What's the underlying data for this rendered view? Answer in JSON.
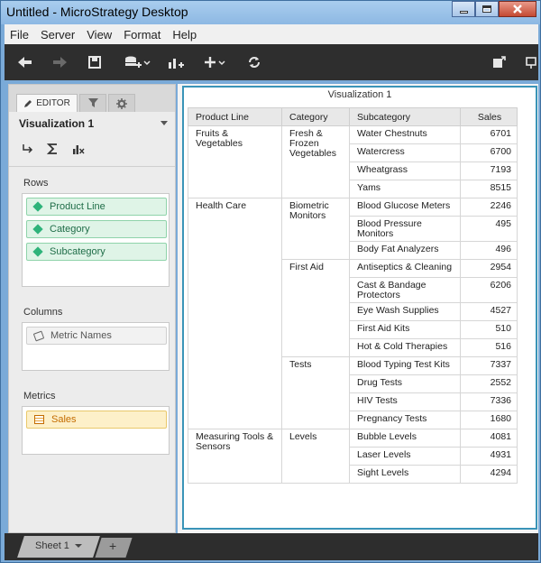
{
  "window": {
    "title": "Untitled - MicroStrategy Desktop"
  },
  "menu": [
    "File",
    "Server",
    "View",
    "Format",
    "Help"
  ],
  "toolbar": {
    "icons": [
      "undo-icon",
      "redo-icon",
      "save-icon",
      "add-data-icon",
      "insert-visualization-icon",
      "add-icon",
      "refresh-icon",
      "export-icon",
      "present-icon"
    ]
  },
  "editor": {
    "tabs": {
      "editor": "EDITOR"
    },
    "visualization_name": "Visualization 1",
    "rows_label": "Rows",
    "rows": [
      "Product Line",
      "Category",
      "Subcategory"
    ],
    "columns_label": "Columns",
    "columns": [
      "Metric Names"
    ],
    "metrics_label": "Metrics",
    "metrics": [
      "Sales"
    ]
  },
  "viz": {
    "title": "Visualization 1",
    "headers": [
      "Product Line",
      "Category",
      "Subcategory",
      "Sales"
    ],
    "groups": [
      {
        "product_line": "Fruits & Vegetables",
        "categories": [
          {
            "name": "Fresh & Frozen Vegetables",
            "rows": [
              [
                "Water Chestnuts",
                "6701"
              ],
              [
                "Watercress",
                "6700"
              ],
              [
                "Wheatgrass",
                "7193"
              ],
              [
                "Yams",
                "8515"
              ]
            ]
          }
        ]
      },
      {
        "product_line": "Health Care",
        "categories": [
          {
            "name": "Biometric Monitors",
            "rows": [
              [
                "Blood Glucose Meters",
                "2246"
              ],
              [
                "Blood Pressure Monitors",
                "495"
              ],
              [
                "Body Fat Analyzers",
                "496"
              ]
            ]
          },
          {
            "name": "First Aid",
            "rows": [
              [
                "Antiseptics & Cleaning",
                "2954"
              ],
              [
                "Cast & Bandage Protectors",
                "6206"
              ],
              [
                "Eye Wash Supplies",
                "4527"
              ],
              [
                "First Aid Kits",
                "510"
              ],
              [
                "Hot & Cold Therapies",
                "516"
              ]
            ]
          },
          {
            "name": "Tests",
            "rows": [
              [
                "Blood Typing Test Kits",
                "7337"
              ],
              [
                "Drug Tests",
                "2552"
              ],
              [
                "HIV Tests",
                "7336"
              ],
              [
                "Pregnancy Tests",
                "1680"
              ]
            ]
          }
        ]
      },
      {
        "product_line": "Measuring Tools & Sensors",
        "categories": [
          {
            "name": "Levels",
            "rows": [
              [
                "Bubble Levels",
                "4081"
              ],
              [
                "Laser Levels",
                "4931"
              ],
              [
                "Sight Levels",
                "4294"
              ]
            ]
          }
        ]
      }
    ]
  },
  "sheets": {
    "active": "Sheet 1",
    "add": "+"
  }
}
